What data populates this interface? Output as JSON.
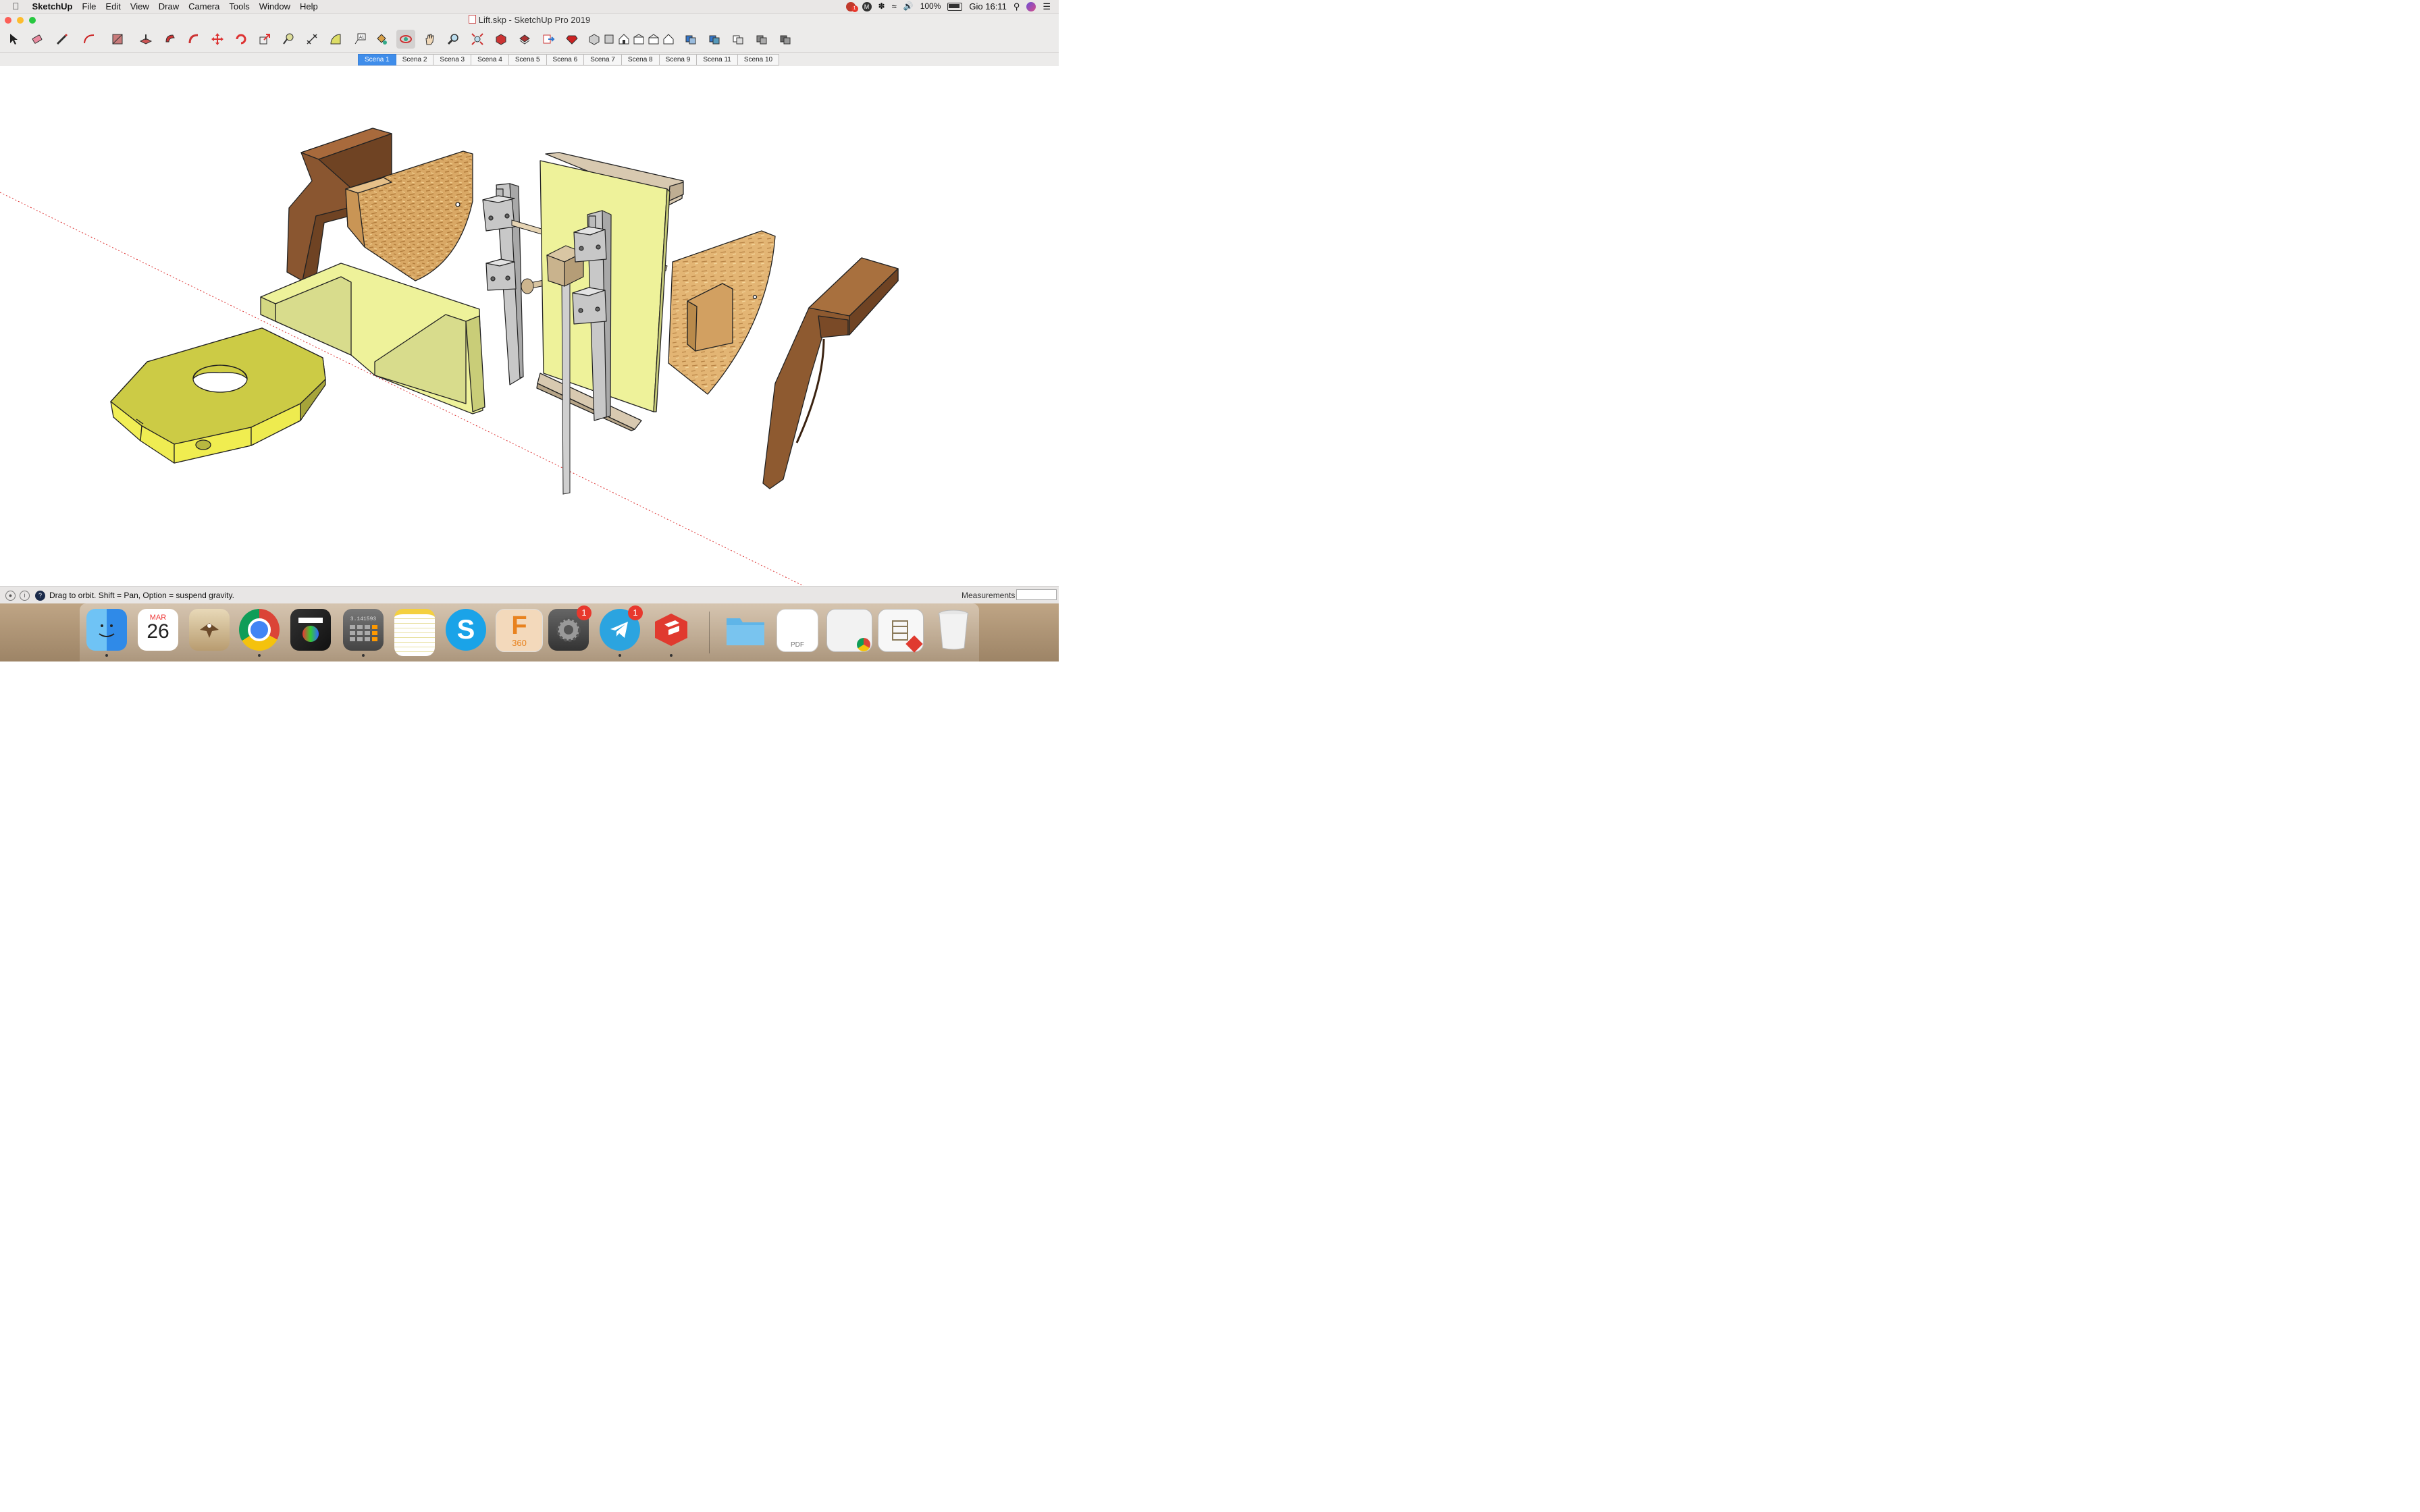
{
  "menubar": {
    "app_name": "SketchUp",
    "items": [
      "File",
      "Edit",
      "View",
      "Draw",
      "Camera",
      "Tools",
      "Window",
      "Help"
    ],
    "battery": "100%",
    "clock": "Gio 16:11"
  },
  "window": {
    "title": "Lift.skp - SketchUp Pro 2019"
  },
  "toolbar": {
    "tools": [
      "select-arrow",
      "eraser",
      "pencil-line",
      "arc",
      "rectangle",
      "push-pull",
      "offset",
      "follow-me",
      "move",
      "rotate",
      "scale",
      "tape-measure",
      "protractor",
      "dimension",
      "text-label",
      "paint-bucket",
      "orbit",
      "pan",
      "zoom",
      "zoom-extents",
      "warehouse",
      "extension-warehouse",
      "send-to-layout",
      "ruby-console",
      "iso-view",
      "top-view",
      "front-view",
      "right-view",
      "back-view",
      "left-view",
      "xray",
      "wireframe",
      "hidden-line",
      "shaded",
      "shaded-textured"
    ],
    "active_tool": "orbit"
  },
  "scenes": {
    "tabs": [
      "Scena 1",
      "Scena 2",
      "Scena 3",
      "Scena 4",
      "Scena 5",
      "Scena 6",
      "Scena 7",
      "Scena 8",
      "Scena 9",
      "Scena 11",
      "Scena 10"
    ],
    "active": "Scena 1"
  },
  "statusbar": {
    "hint": "Drag to orbit. Shift = Pan, Option = suspend gravity.",
    "measurements_label": "Measurements",
    "measurements_value": ""
  },
  "dock": {
    "calendar_month": "MAR",
    "calendar_day": "26",
    "system_prefs_badge": "1",
    "telegram_badge": "1",
    "fusion_label": "360",
    "pdf_label": "PDF",
    "calculator_display": "3.141593",
    "menubar_notification_badge": "1"
  },
  "colors": {
    "accent": "#3f8dea",
    "wood_dark": "#8a5630",
    "wood_light": "#d8a868",
    "pale_yellow": "#eef29a",
    "bright_yellow": "#e8e64a"
  }
}
